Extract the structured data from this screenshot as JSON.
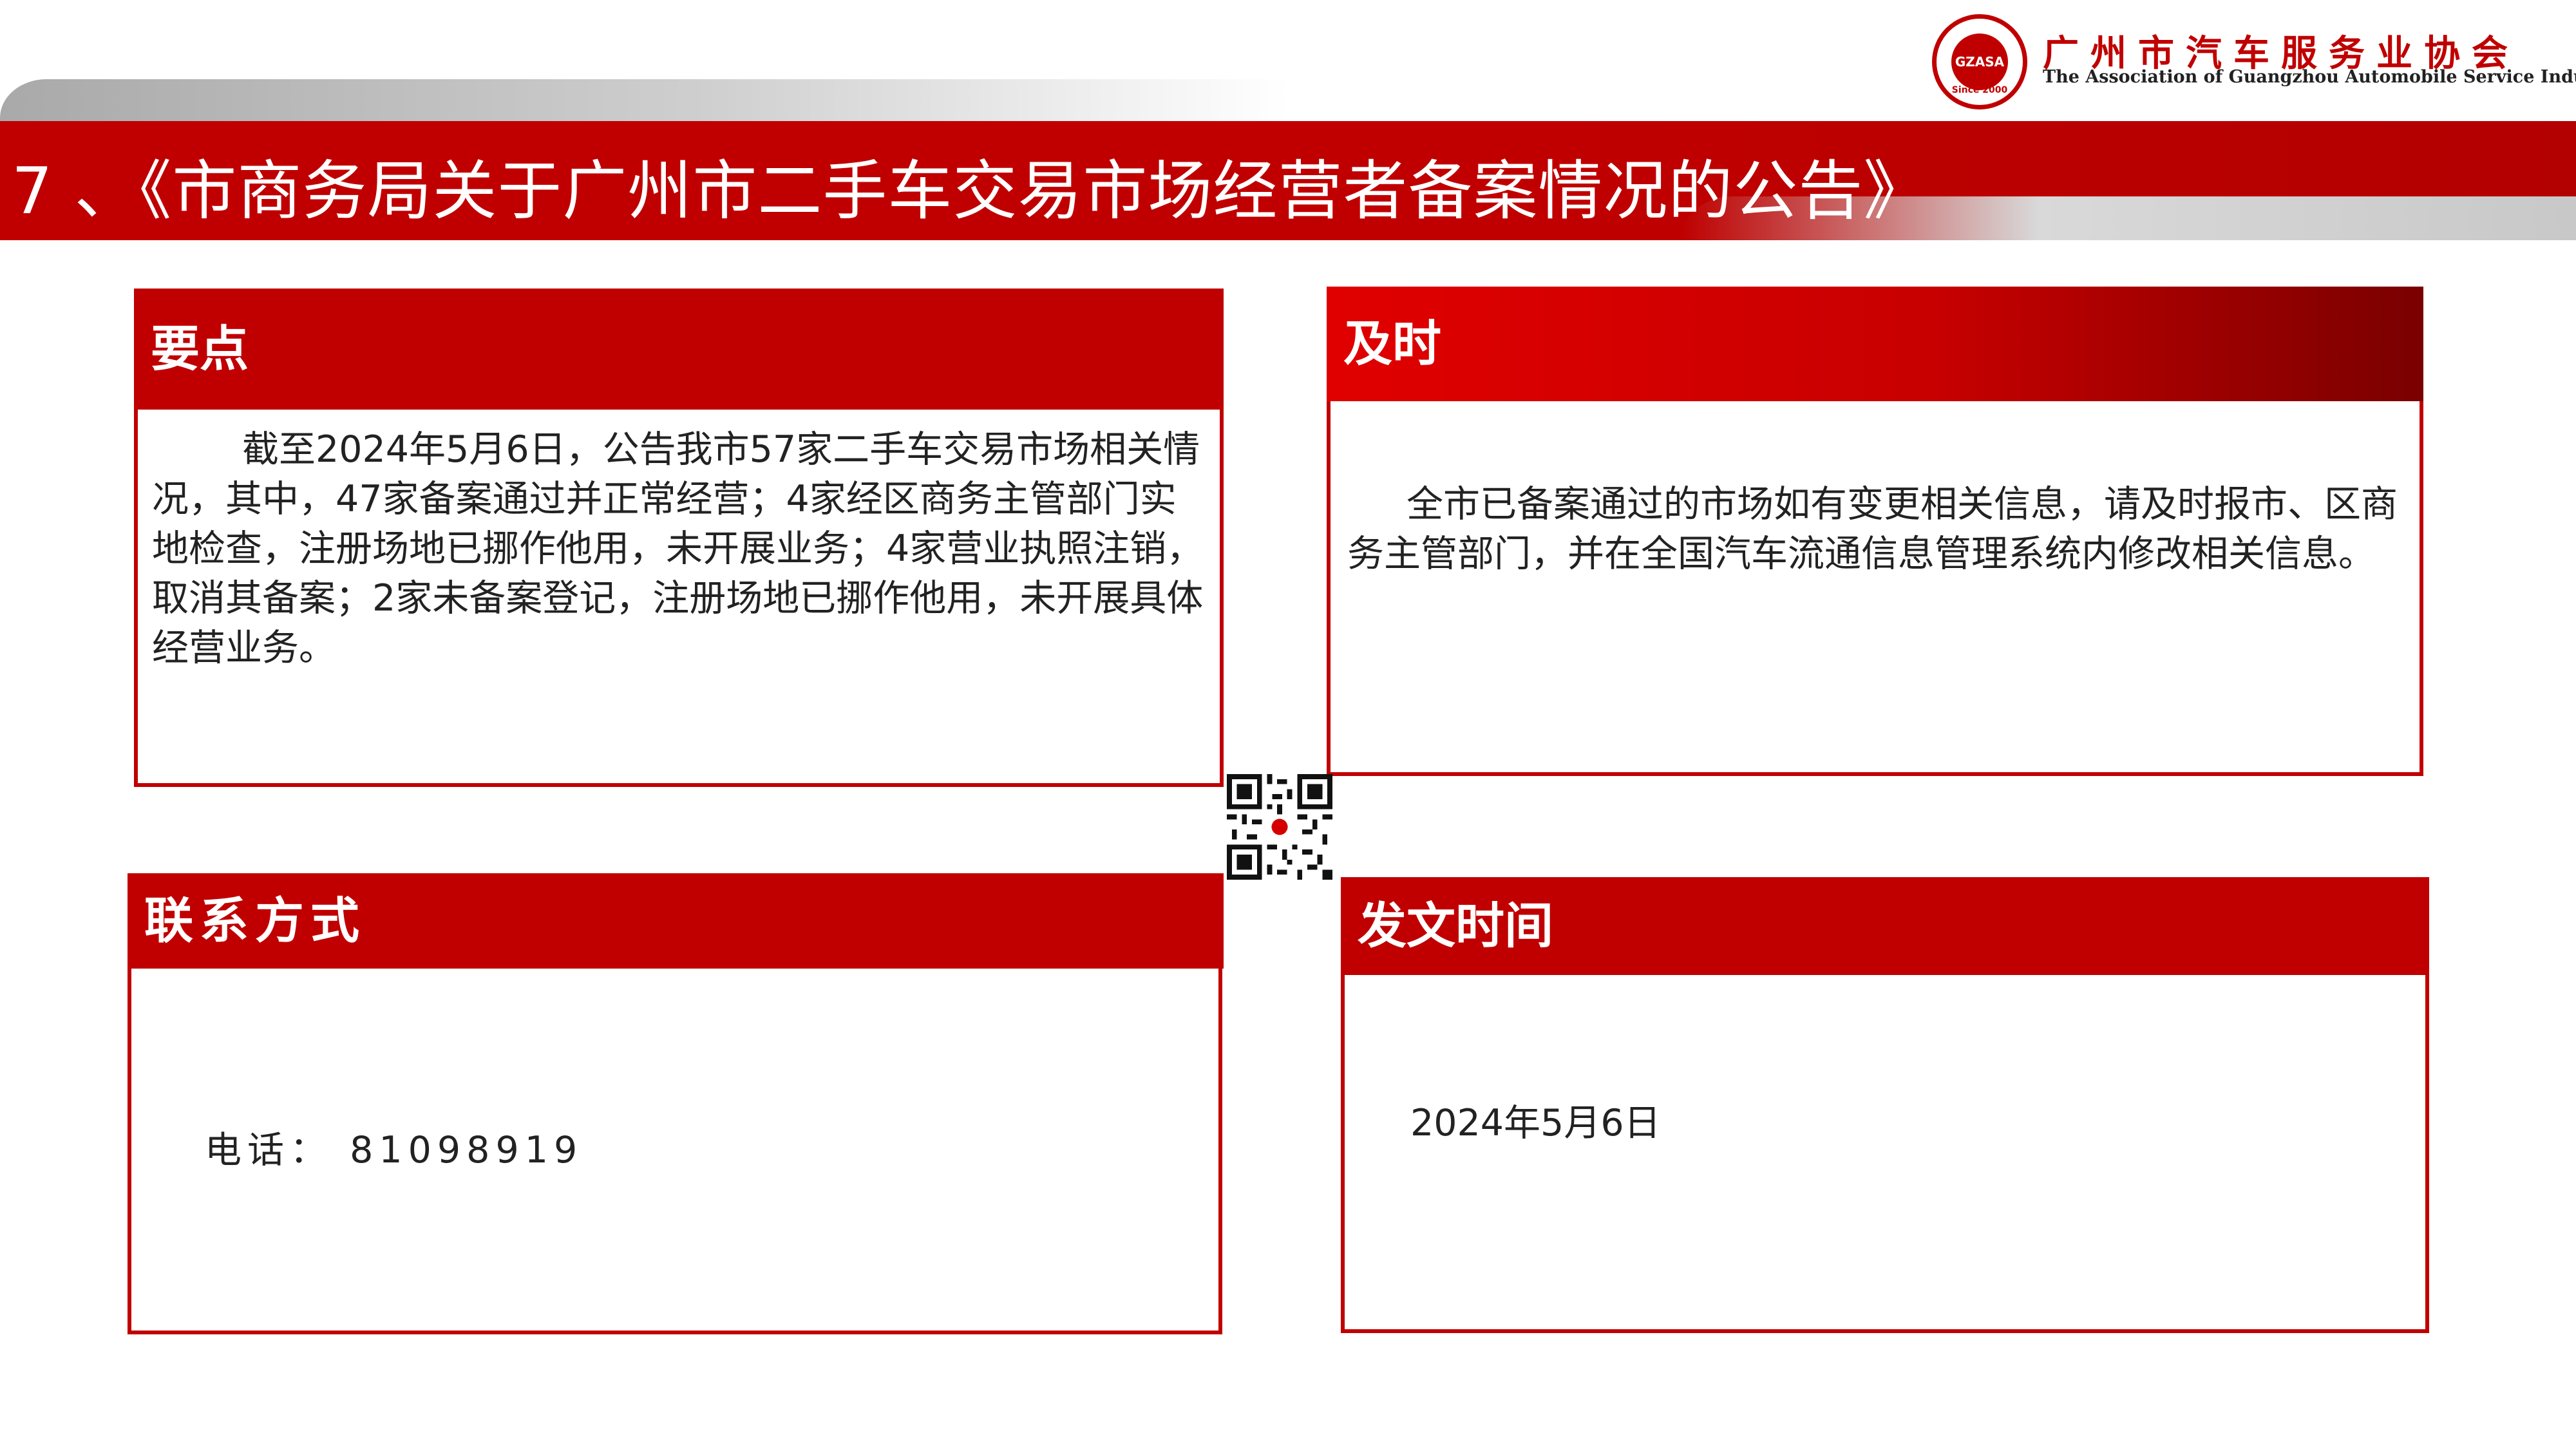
{
  "header": {
    "slide_title": "7 、《市商务局关于广州市二手车交易市场经营者备案情况的公告》",
    "logo": {
      "cn_name": "广州市汽车服务业协会",
      "en_name": "The Association of Guangzhou Automobile Service Industry",
      "ring_text": "GZASA",
      "since": "Since 2000"
    }
  },
  "panels": {
    "key_points": {
      "heading": "要点",
      "body": "截至2024年5月6日，公告我市57家二手车交易市场相关情况，其中，47家备案通过并正常经营；4家经区商务主管部门实地检查，注册场地已挪作他用，未开展业务；4家营业执照注销，取消其备案；2家未备案登记，注册场地已挪作他用，未开展具体经营业务。"
    },
    "timely": {
      "heading": "及时",
      "body": "全市已备案通过的市场如有变更相关信息，请及时报市、区商务主管部门，并在全国汽车流通信息管理系统内修改相关信息。"
    },
    "contact": {
      "heading": "联系方式",
      "phone": "电话： 81098919"
    },
    "issue_date": {
      "heading": "发文时间",
      "date": "2024年5月6日"
    }
  },
  "colors": {
    "brand_red": "#c00000",
    "dark_red": "#7a0000"
  },
  "icons": {
    "qr": "qr-code-icon",
    "logo": "association-logo-icon"
  }
}
